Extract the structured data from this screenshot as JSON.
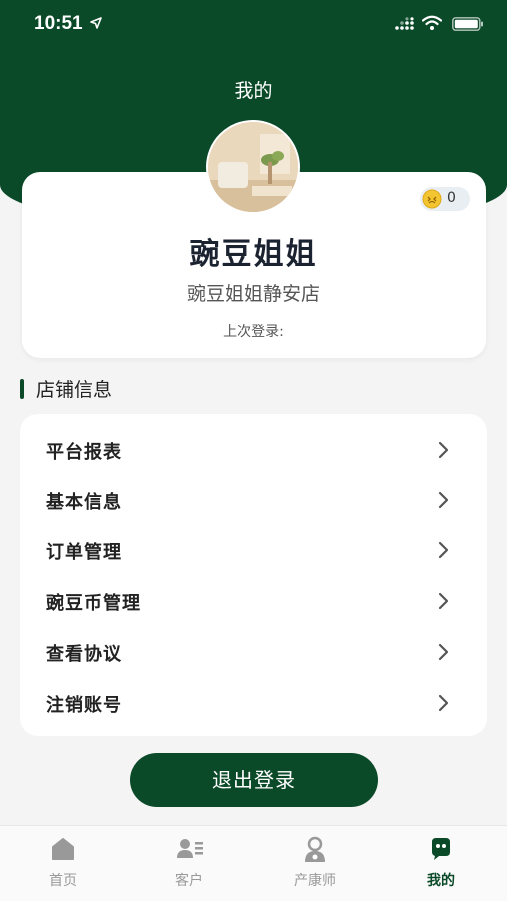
{
  "status_bar": {
    "time": "10:51"
  },
  "header": {
    "title": "我的"
  },
  "profile": {
    "coin_count": "0",
    "name": "豌豆姐姐",
    "store": "豌豆姐姐静安店",
    "last_login_label": "上次登录:"
  },
  "section": {
    "title": "店铺信息"
  },
  "menu": {
    "items": [
      {
        "label": "平台报表"
      },
      {
        "label": "基本信息"
      },
      {
        "label": "订单管理"
      },
      {
        "label": "豌豆币管理"
      },
      {
        "label": "查看协议"
      },
      {
        "label": "注销账号"
      }
    ]
  },
  "logout": {
    "label": "退出登录"
  },
  "tabs": [
    {
      "label": "首页",
      "icon": "home-icon"
    },
    {
      "label": "客户",
      "icon": "customers-icon"
    },
    {
      "label": "产康师",
      "icon": "therapist-icon"
    },
    {
      "label": "我的",
      "icon": "mine-icon",
      "active": true
    }
  ],
  "colors": {
    "brand": "#0b4a29",
    "background": "#f4f4f4",
    "coin": "#f3c530"
  }
}
